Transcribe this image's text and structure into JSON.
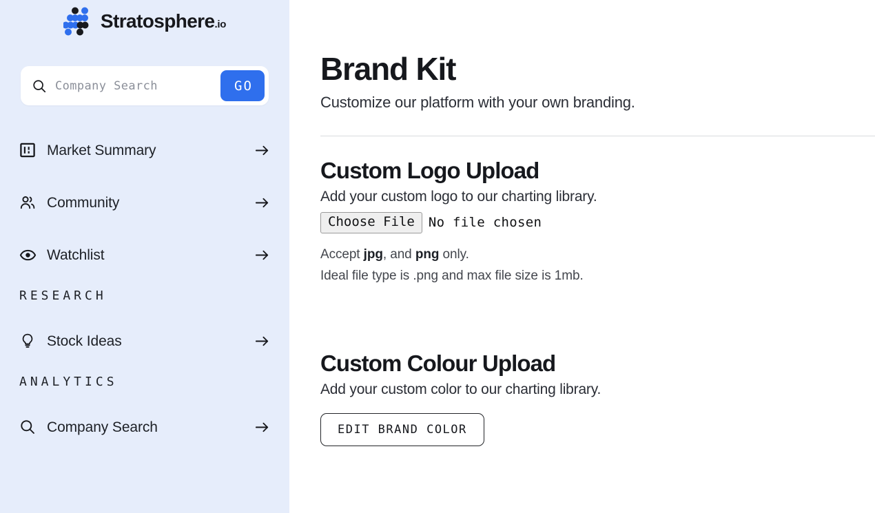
{
  "brand": {
    "name": "Stratosphere",
    "suffix": ".io",
    "logo_icon": "dot-matrix-logo-icon",
    "accent_color": "#2f6fed",
    "logo_dark_color": "#18191d",
    "sidebar_bg": "#e6edfb"
  },
  "search": {
    "placeholder": "Company Search",
    "value": "",
    "icon": "search-icon",
    "go_label": "GO"
  },
  "sidebar": {
    "items": [
      {
        "label": "Market Summary",
        "icon": "chart-square-icon",
        "arrow": "arrow-right-icon"
      },
      {
        "label": "Community",
        "icon": "users-icon",
        "arrow": "arrow-right-icon"
      },
      {
        "label": "Watchlist",
        "icon": "eye-icon",
        "arrow": "arrow-right-icon"
      }
    ],
    "sections": [
      {
        "title": "RESEARCH",
        "items": [
          {
            "label": "Stock Ideas",
            "icon": "lightbulb-icon",
            "arrow": "arrow-right-icon"
          }
        ]
      },
      {
        "title": "ANALYTICS",
        "items": [
          {
            "label": "Company Search",
            "icon": "search-icon",
            "arrow": "arrow-right-icon"
          }
        ]
      }
    ]
  },
  "main": {
    "title": "Brand Kit",
    "subtitle": "Customize our platform with your own branding.",
    "logo_section": {
      "title": "Custom Logo Upload",
      "description": "Add your custom logo to our charting library.",
      "choose_file_label": "Choose File",
      "file_status": "No file chosen",
      "hint_prefix": "Accept ",
      "hint_bold_1": "jpg",
      "hint_middle": ", and ",
      "hint_bold_2": "png",
      "hint_suffix": " only.",
      "hint_line_2": "Ideal file type is .png and max file size is 1mb."
    },
    "colour_section": {
      "title": "Custom Colour Upload",
      "description": "Add your custom color to our charting library.",
      "edit_button_label": "EDIT BRAND COLOR"
    }
  }
}
